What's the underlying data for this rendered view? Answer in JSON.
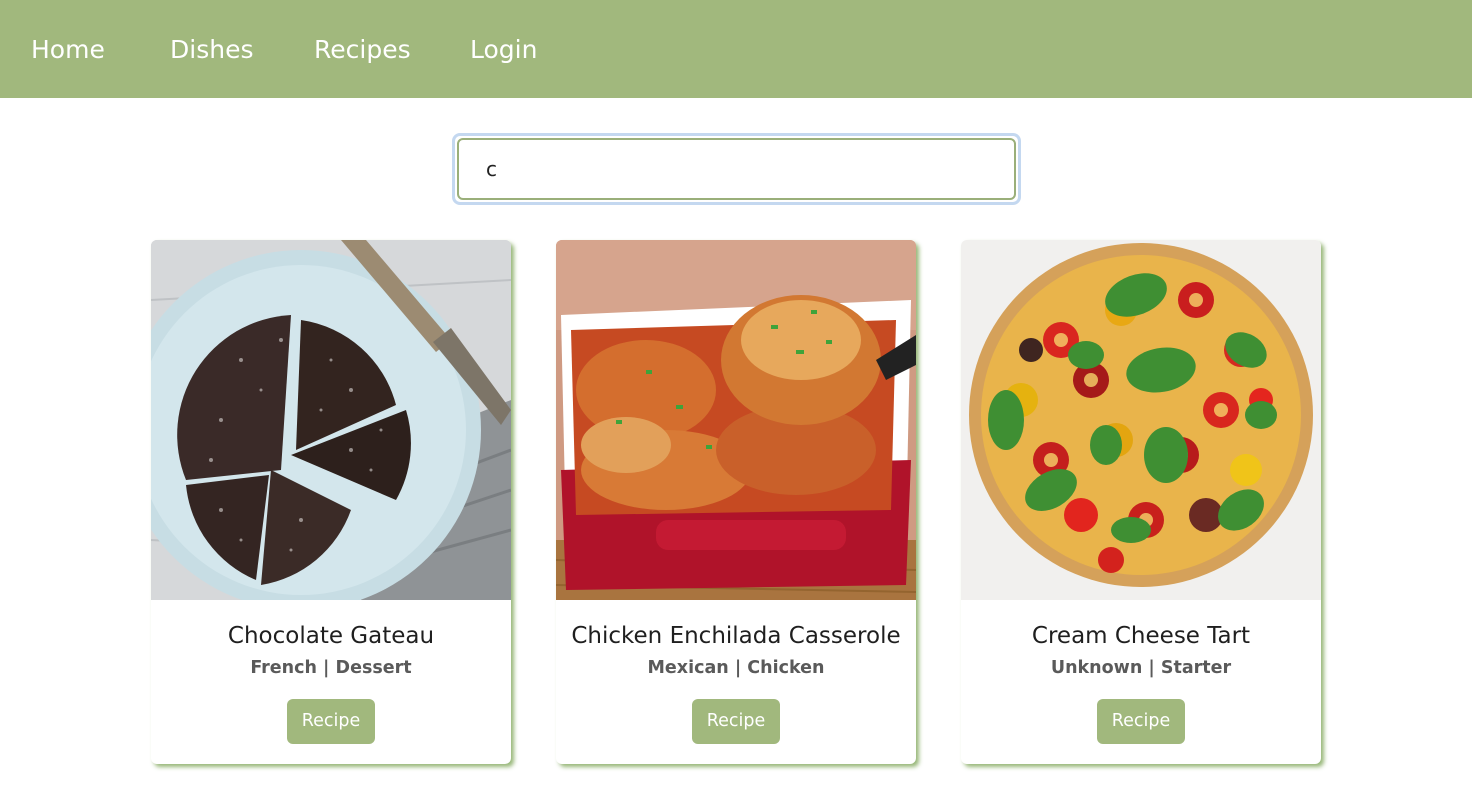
{
  "nav": {
    "items": [
      {
        "label": "Home"
      },
      {
        "label": "Dishes"
      },
      {
        "label": "Recipes"
      },
      {
        "label": "Login"
      }
    ]
  },
  "search": {
    "value": "c"
  },
  "cards": [
    {
      "title": "Chocolate Gateau",
      "subtitle": "French | Dessert",
      "button_label": "Recipe",
      "image_icon": "chocolate-gateau-image"
    },
    {
      "title": "Chicken Enchilada Casserole",
      "subtitle": "Mexican | Chicken",
      "button_label": "Recipe",
      "image_icon": "chicken-enchilada-casserole-image"
    },
    {
      "title": "Cream Cheese Tart",
      "subtitle": "Unknown | Starter",
      "button_label": "Recipe",
      "image_icon": "cream-cheese-tart-image"
    }
  ],
  "colors": {
    "accent": "#a1b87d",
    "nav_text": "#ffffff",
    "card_shadow": "#8caf69",
    "search_focus_ring": "#c4d8f0"
  }
}
